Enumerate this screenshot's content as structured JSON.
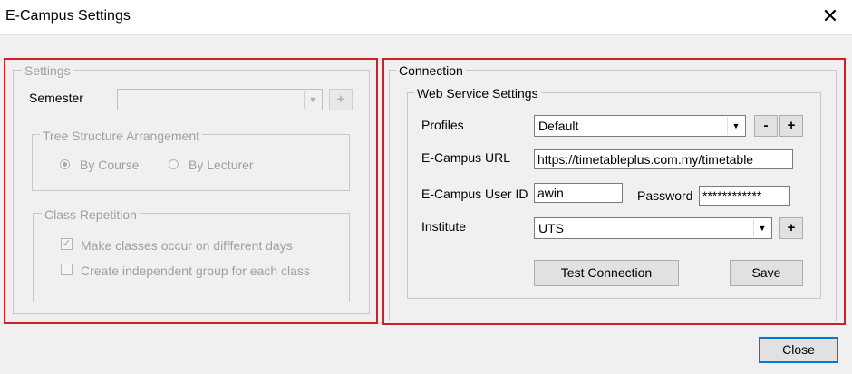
{
  "window": {
    "title": "E-Campus Settings",
    "close_glyph": "✕"
  },
  "settings": {
    "legend": "Settings",
    "semester_label": "Semester",
    "semester_value": "",
    "semester_add": "+",
    "tree": {
      "legend": "Tree Structure Arrangement",
      "by_course": "By Course",
      "by_lecturer": "By Lecturer",
      "selected": "by_course"
    },
    "repetition": {
      "legend": "Class Repetition",
      "different_days": "Make classes occur on diffferent days",
      "different_days_checked": true,
      "independent_group": "Create independent group for each class",
      "independent_group_checked": false
    }
  },
  "connection": {
    "legend": "Connection",
    "web": {
      "legend": "Web Service Settings",
      "profiles_label": "Profiles",
      "profiles_value": "Default",
      "minus": "-",
      "plus": "+",
      "url_label": "E-Campus URL",
      "url_value": "https://timetableplus.com.my/timetable",
      "user_label": "E-Campus User ID",
      "user_value": "awin",
      "password_label": "Password",
      "password_value": "************",
      "institute_label": "Institute",
      "institute_value": "UTS",
      "institute_add": "+",
      "test_button": "Test Connection",
      "save_button": "Save"
    }
  },
  "footer": {
    "close_button": "Close"
  },
  "icons": {
    "dropdown": "▼",
    "check": "✓"
  },
  "colors": {
    "highlight_box": "#d01f2b"
  }
}
